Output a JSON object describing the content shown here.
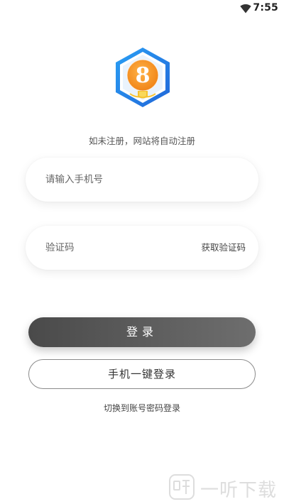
{
  "status_bar": {
    "time": "7:55",
    "wifi_icon": "wifi-icon"
  },
  "logo": {
    "text": "8",
    "colors": {
      "hex_outer": "#2f8ef0",
      "hex_inner": "#ffffff",
      "circle": "#f39a1b",
      "badge": "#f6c12d"
    }
  },
  "hint": "如未注册，网站将自动注册",
  "phone_input": {
    "value": "",
    "placeholder": "请输入手机号"
  },
  "code_input": {
    "value": "",
    "placeholder": "验证码",
    "get_code_label": "获取验证码"
  },
  "login_button_label": "登录",
  "one_click_login_label": "手机一键登录",
  "switch_login_label": "切换到账号密码登录",
  "watermark": {
    "text": "一听下载",
    "icon": "ting-logo-icon"
  }
}
